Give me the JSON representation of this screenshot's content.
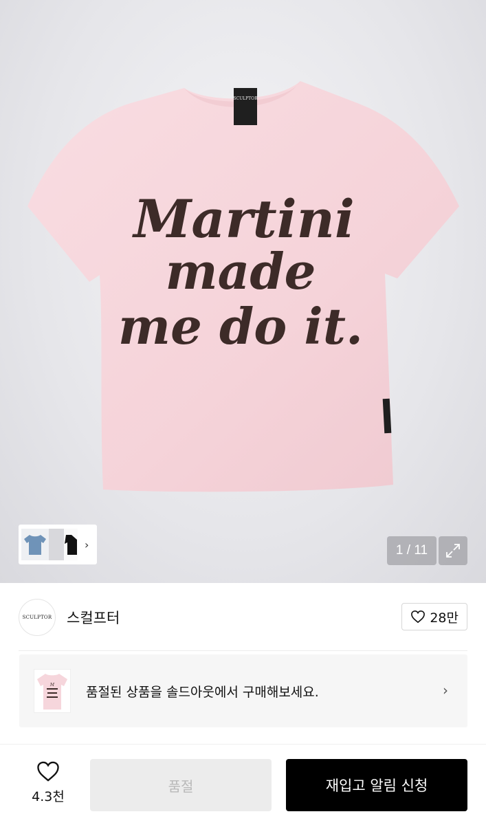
{
  "product_image": {
    "print_text_line1": "Martini",
    "print_text_line2": "made",
    "print_text_line3": "me do it.",
    "collar_label": "SCULPTOR",
    "counter": "1 / 11",
    "shirt_color": "#f6d6dc",
    "print_color": "#3d2b28",
    "thumbnail_colors": [
      "#6f93b8",
      "#e9e6e2",
      "#111111"
    ]
  },
  "brand": {
    "logo_text": "SCULPTOR",
    "name": "스컬프터",
    "likes": "28만"
  },
  "soldout_banner": {
    "text": "품절된 상품을 솔드아웃에서 구매해보세요."
  },
  "bottom_bar": {
    "wishlist_count": "4.3천",
    "soldout_label": "품절",
    "restock_label": "재입고 알림 신청"
  }
}
